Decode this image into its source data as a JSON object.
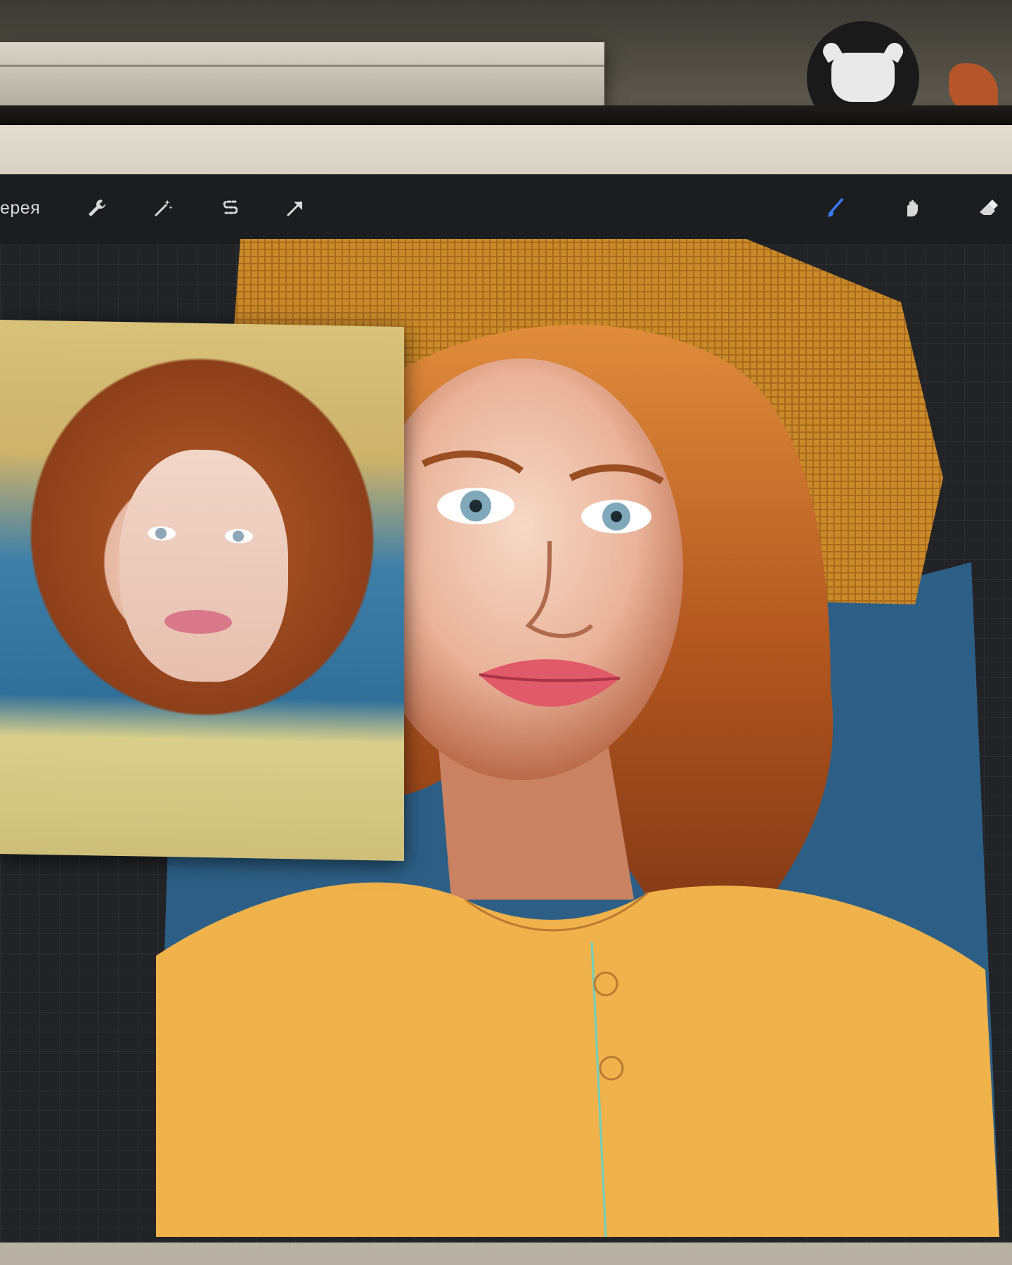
{
  "toolbar": {
    "gallery_label": "ерея",
    "icons": {
      "actions": "wrench-icon",
      "adjustments": "magic-wand-icon",
      "selection": "selection-s-icon",
      "transform": "arrow-icon",
      "brush": "brush-icon",
      "smudge": "smudge-icon",
      "eraser": "eraser-icon"
    },
    "brush_active_color": "#3a7bff"
  },
  "colors": {
    "screen_bg": "#1c1d20",
    "canvas_bg": "#222327",
    "hat": "#c98a2a",
    "hair": "#b65a24",
    "skin": "#f0c7b0",
    "shirt": "#f0b24a",
    "background_blue": "#2d5f86"
  }
}
